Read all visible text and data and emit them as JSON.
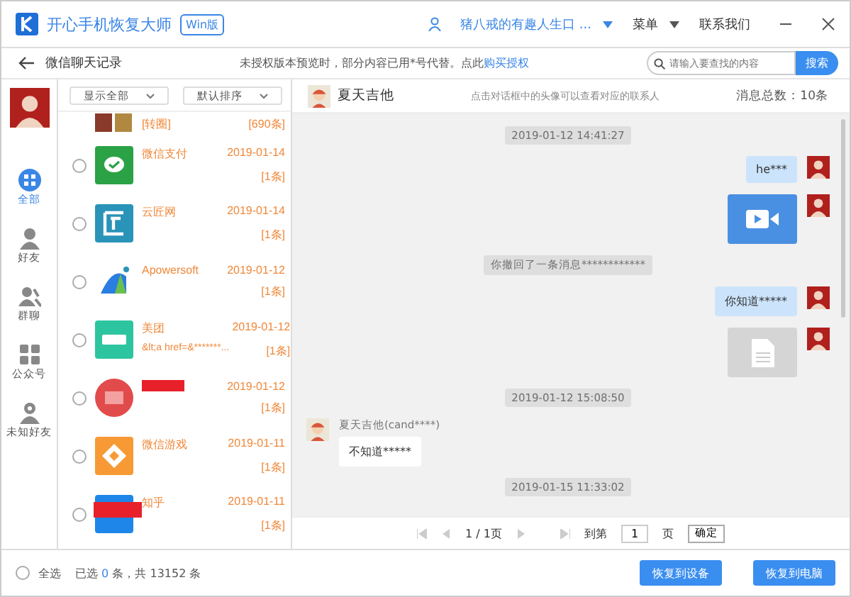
{
  "app": {
    "title": "开心手机恢复大师",
    "edition": "Win版",
    "user": "猪八戒的有趣人生口 ...",
    "menu": "菜单",
    "contact": "联系我们"
  },
  "toolbar": {
    "title": "微信聊天记录",
    "notice": "未授权版本预览时，部分内容已用*号代替。点此",
    "notice_link": "购买授权",
    "search_placeholder": "请输入要查找的内容",
    "search_button": "搜索"
  },
  "nav": [
    {
      "label": "全部",
      "selected": true
    },
    {
      "label": "好友",
      "selected": false
    },
    {
      "label": "群聊",
      "selected": false
    },
    {
      "label": "公众号",
      "selected": false
    },
    {
      "label": "未知好友",
      "selected": false
    }
  ],
  "filters": [
    "显示全部",
    "默认排序"
  ],
  "contacts": [
    {
      "kind": "partial",
      "subtitle": "[转圈]",
      "count": "[690条]"
    },
    {
      "kind": "full",
      "name": "微信支付",
      "date": "2019-01-14",
      "count": "[1条]",
      "checked": false
    },
    {
      "kind": "full",
      "name": "云匠网",
      "date": "2019-01-14",
      "count": "[1条]",
      "checked": false
    },
    {
      "kind": "full",
      "name": "Apowersoft",
      "date": "2019-01-12",
      "count": "[1条]",
      "checked": false
    },
    {
      "kind": "full",
      "name": "美团",
      "subtitle": "&lt;a href=&*******...",
      "date": "2019-01-12",
      "count": "[1条]",
      "checked": false
    },
    {
      "kind": "name_covered",
      "date": "2019-01-12",
      "count": "[1条]",
      "checked": false
    },
    {
      "kind": "full",
      "name": "微信游戏",
      "date": "2019-01-11",
      "count": "[1条]",
      "checked": false
    },
    {
      "kind": "icon_covered",
      "name": "知乎",
      "date": "2019-01-11",
      "count": "[1条]",
      "checked": false
    }
  ],
  "chat": {
    "name": "夏天吉他",
    "hint": "点击对话框中的头像可以查看对应的联系人",
    "total": "消息总数：10条",
    "messages": [
      {
        "kind": "time",
        "text": "2019-01-12 14:41:27"
      },
      {
        "kind": "sent_text",
        "text": "he***"
      },
      {
        "kind": "sent_video"
      },
      {
        "kind": "notice",
        "text": "你撤回了一条消息************"
      },
      {
        "kind": "sent_text",
        "text": "你知道*****"
      },
      {
        "kind": "sent_file"
      },
      {
        "kind": "time",
        "text": "2019-01-12 15:08:50"
      },
      {
        "kind": "received_text",
        "sender": "夏天吉他(cand****)",
        "text": "不知道*****"
      },
      {
        "kind": "time",
        "text": "2019-01-15 11:33:02"
      }
    ],
    "pager": {
      "page": "1 / 1页",
      "goto": "到第",
      "value": "1",
      "unit": "页",
      "confirm": "确定"
    }
  },
  "footer": {
    "select_all": "全选",
    "select_all_checked": false,
    "status_pre": "已选 ",
    "selected": "0",
    "status_post": " 条，共 13152 条",
    "buttons": [
      "恢复到设备",
      "恢复到电脑"
    ]
  }
}
